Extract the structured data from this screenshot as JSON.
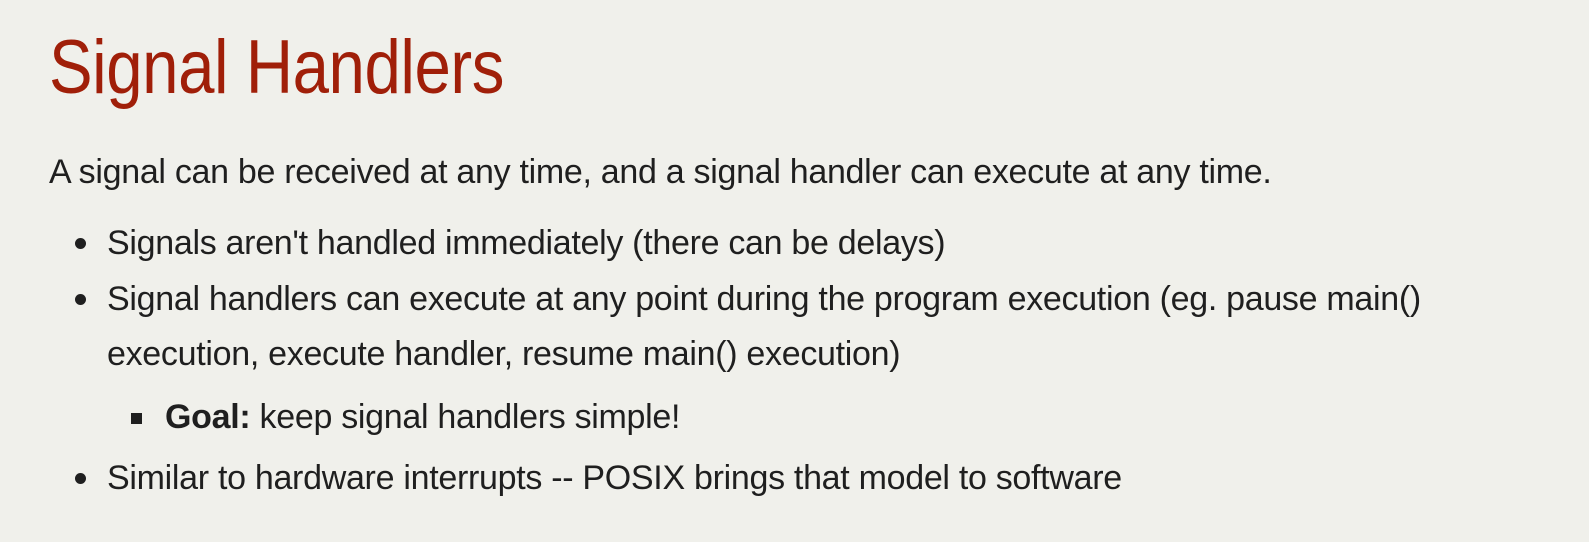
{
  "slide": {
    "title": "Signal Handlers",
    "intro": "A signal can be received at any time, and a signal handler can execute at any time.",
    "bullets": [
      "Signals aren't handled immediately (there can be delays)",
      "Signal handlers can execute at any point during the program execution (eg. pause main() execution, execute handler, resume main() execution)",
      "Similar to hardware interrupts -- POSIX brings that model to software"
    ],
    "sub_bullet": {
      "label": "Goal:",
      "text": " keep signal handlers simple!"
    }
  },
  "colors": {
    "background": "#f0f0eb",
    "title": "#a01f09",
    "text": "#1f1f1f"
  }
}
